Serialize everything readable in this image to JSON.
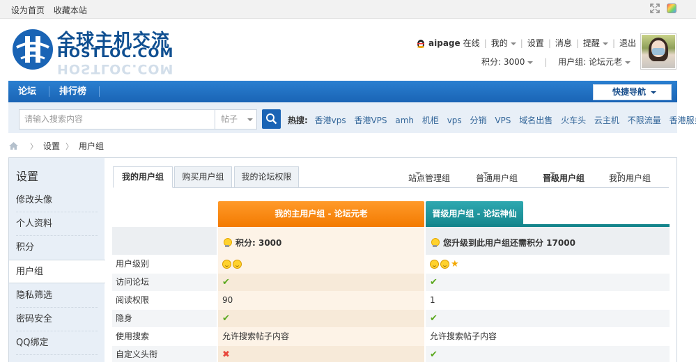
{
  "topbar": {
    "set_home": "设为首页",
    "bookmark": "收藏本站"
  },
  "logo": {
    "cn": "全球主机交流",
    "en": "HOSTLOC.COM"
  },
  "user": {
    "name": "aipage",
    "online": "在线",
    "my": "我的",
    "settings": "设置",
    "messages": "消息",
    "reminders": "提醒",
    "logout": "退出",
    "points": "积分: 3000",
    "group": "用户组: 论坛元老"
  },
  "nav": {
    "forum": "论坛",
    "ranking": "排行榜",
    "quick_nav": "快捷导航"
  },
  "search": {
    "placeholder": "请输入搜索内容",
    "type": "帖子",
    "hot_label": "热搜:",
    "hot": [
      "香港vps",
      "香港VPS",
      "amh",
      "机柜",
      "vps",
      "分销",
      "VPS",
      "域名出售",
      "火车头",
      "云主机",
      "不限流量",
      "香港服务器"
    ]
  },
  "breadcrumb": {
    "settings": "设置",
    "usergroup": "用户组"
  },
  "sidebar": {
    "title": "设置",
    "items": [
      "修改头像",
      "个人资料",
      "积分",
      "用户组",
      "隐私筛选",
      "密码安全",
      "QQ绑定"
    ]
  },
  "tabs": [
    "我的用户组",
    "购买用户组",
    "我的论坛权限"
  ],
  "group_links": [
    "站点管理组",
    "普通用户组",
    "晋级用户组",
    "我的用户组"
  ],
  "table": {
    "main_header": "我的主用户组 - 论坛元老",
    "upgrade_header": "晋级用户组 - 论坛神仙",
    "main_score": "积分: 3000",
    "upgrade_score": "您升级到此用户组还需积分 17000",
    "rows": [
      {
        "label": "用户级别",
        "v1": "",
        "v2": ""
      },
      {
        "label": "访问论坛",
        "v1": "",
        "v2": ""
      },
      {
        "label": "阅读权限",
        "v1": "90",
        "v2": "1"
      },
      {
        "label": "隐身",
        "v1": "",
        "v2": ""
      },
      {
        "label": "使用搜索",
        "v1": "允许搜索帖子内容",
        "v2": "允许搜索帖子内容"
      },
      {
        "label": "自定义头衔",
        "v1": "",
        "v2": ""
      }
    ]
  },
  "colors": {
    "nav_blue": "#1a64b5",
    "orange": "#f37a00",
    "teal": "#14858c"
  }
}
